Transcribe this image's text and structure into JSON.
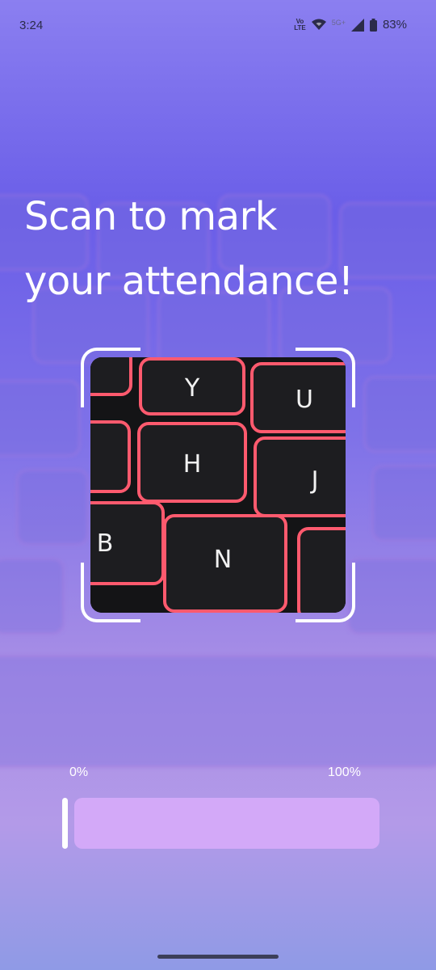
{
  "status_bar": {
    "time": "3:24",
    "volte_top": "Vo",
    "volte_bottom": "LTE",
    "network": "5G+",
    "battery": "83%",
    "icons": [
      "volte-icon",
      "wifi-icon",
      "signal-icon",
      "battery-icon"
    ]
  },
  "headline": {
    "line1": "Scan to mark",
    "line2": "your attendance!"
  },
  "progress": {
    "start_label": "0%",
    "end_label": "100%",
    "value_fraction": 0
  },
  "camera": {
    "keys": [
      "Y",
      "U",
      "H",
      "J",
      "B",
      "N"
    ]
  },
  "colors": {
    "progress_track": "#d3a9f8",
    "key_glow": "#ff5a6e"
  }
}
